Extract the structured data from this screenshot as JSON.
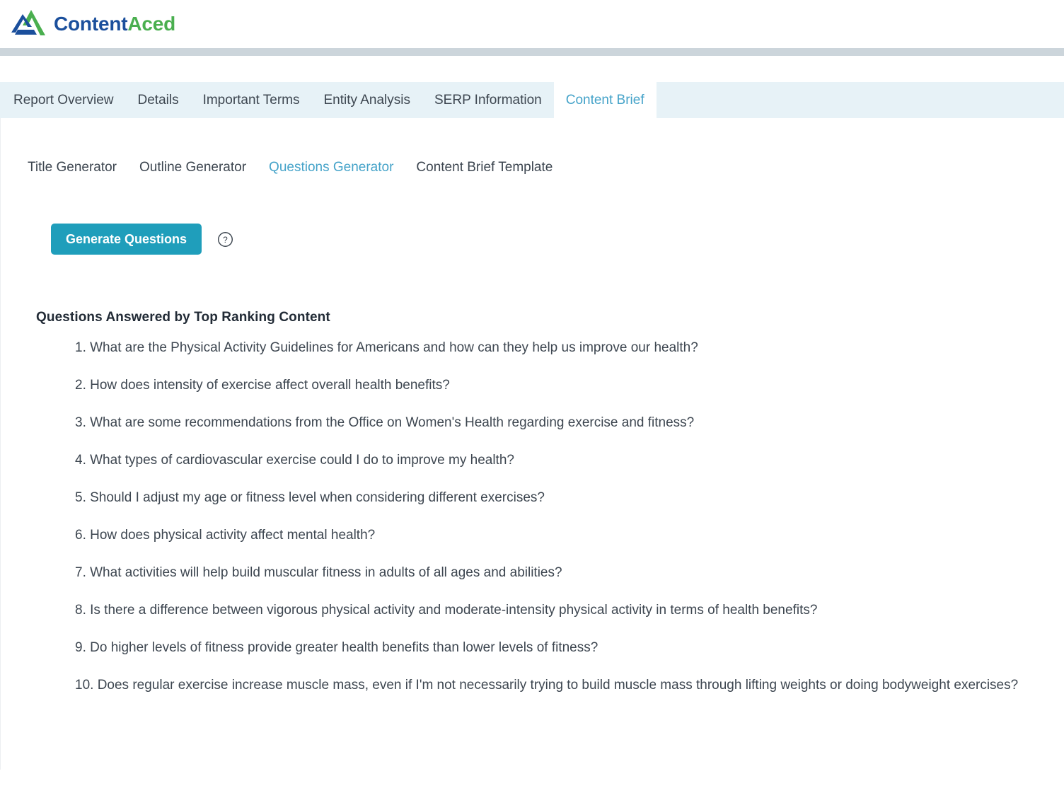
{
  "brand": {
    "name_part1": "Content",
    "name_part2": "Aced",
    "logo_icon": "contentaced-logo-icon",
    "colors": {
      "blue": "#1b4f9c",
      "green": "#4aaf4f",
      "accent_teal": "#1f9ebb",
      "active_tab_text": "#45a3c9",
      "tabstrip_bg": "#e7f2f7",
      "gray_band": "#ccd5db"
    }
  },
  "tabs": [
    {
      "label": "Report Overview",
      "active": false
    },
    {
      "label": "Details",
      "active": false
    },
    {
      "label": "Important Terms",
      "active": false
    },
    {
      "label": "Entity Analysis",
      "active": false
    },
    {
      "label": "SERP Information",
      "active": false
    },
    {
      "label": "Content Brief",
      "active": true
    }
  ],
  "subtabs": [
    {
      "label": "Title Generator",
      "active": false
    },
    {
      "label": "Outline Generator",
      "active": false
    },
    {
      "label": "Questions Generator",
      "active": true
    },
    {
      "label": "Content Brief Template",
      "active": false
    }
  ],
  "actions": {
    "generate_questions_label": "Generate Questions",
    "help_icon": "question-mark-circle-icon",
    "help_glyph": "?"
  },
  "questions_section": {
    "heading": "Questions Answered by Top Ranking Content",
    "items": [
      "1. What are the Physical Activity Guidelines for Americans and how can they help us improve our health?",
      "2. How does intensity of exercise affect overall health benefits?",
      "3. What are some recommendations from the Office on Women's Health regarding exercise and fitness?",
      "4. What types of cardiovascular exercise could I do to improve my health?",
      "5. Should I adjust my age or fitness level when considering different exercises?",
      "6. How does physical activity affect mental health?",
      "7. What activities will help build muscular fitness in adults of all ages and abilities?",
      "8. Is there a difference between vigorous physical activity and moderate-intensity physical activity in terms of health benefits?",
      "9. Do higher levels of fitness provide greater health benefits than lower levels of fitness?",
      "10. Does regular exercise increase muscle mass, even if I'm not necessarily trying to build muscle mass through lifting weights or doing bodyweight exercises?"
    ]
  }
}
